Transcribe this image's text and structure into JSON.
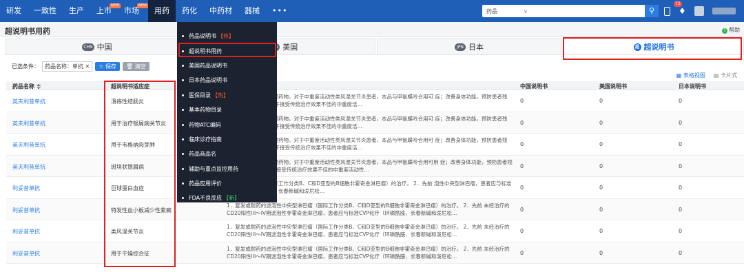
{
  "nav": {
    "items": [
      {
        "label": "研发",
        "tag": ""
      },
      {
        "label": "一致性",
        "tag": ""
      },
      {
        "label": "生产",
        "tag": ""
      },
      {
        "label": "上市",
        "tag": "NEW"
      },
      {
        "label": "市场",
        "tag": "NEW"
      },
      {
        "label": "用药",
        "tag": ""
      },
      {
        "label": "药化",
        "tag": ""
      },
      {
        "label": "中药材",
        "tag": ""
      },
      {
        "label": "器械",
        "tag": ""
      }
    ],
    "more": "•••",
    "search_category": "药品",
    "search_caret": "∨",
    "search_icon": "⚲",
    "notification_count": "72"
  },
  "header": {
    "title": "超说明书用药",
    "help": "帮助",
    "help_icon": "!"
  },
  "tabs": [
    {
      "flag": "CHN",
      "label": "中国"
    },
    {
      "flag": "USA",
      "label": "美国"
    },
    {
      "flag": "JPN",
      "label": "日本"
    },
    {
      "flag": "超",
      "label": "超说明书"
    }
  ],
  "filters": {
    "label": "已选条件：",
    "chip": "药品名称：单抗 ✕",
    "save": "☆ 保存",
    "clear": "🗑 清空"
  },
  "views": {
    "table": "▦ 表格视图",
    "card": "▤ 卡片式"
  },
  "table": {
    "headers": [
      "药品名称 ≑",
      "超说明书适应症",
      "中国说明书",
      "美国说明书",
      "日本说明书"
    ],
    "rows": [
      {
        "name": "英夫利昔单抗",
        "indication": "溃疡性结肠炎",
        "desc": "品是疾病控制性抗风湿药物。对于中重度活动性类风湿关节炎患者，本品与甲氨蝶呤合用可 症；改善身体功能，预防患者残疾。 2．克罗恩病 对于接受传统治疗效果不佳的中重度活…",
        "cn": "0",
        "us": "0",
        "jp": "0"
      },
      {
        "name": "英夫利昔单抗",
        "indication": "用于治疗银屑病关节炎",
        "desc": "品是疾病控制性抗风湿药物。对于中重度活动性类风湿关节炎患者，本品与甲氨蝶呤合用可 症；改善身体功能，预防患者残疾。 2．克罗恩病 对于接受传统治疗效果不佳的中重度活…",
        "cn": "0",
        "us": "0",
        "jp": "0"
      },
      {
        "name": "英夫利昔单抗",
        "indication": "用于韦格纳肉芽肿",
        "desc": "品是疾病控制性抗风湿药物。对于中重度活动性类风湿关节炎患者，本品与甲氨蝶呤合用可 症；改善身体功能，预防患者残疾。 2．克罗恩病 对于接受传统治疗效果不佳的中重度活…",
        "cn": "0",
        "us": "0",
        "jp": "0"
      },
      {
        "name": "英夫利昔单抗",
        "indication": "斑块状银屑病",
        "desc": "品是疾病控制性抗风湿药物。对于中重度活动性类风湿关节炎患者，本品与甲氨蝶呤合用可用 症；改善身体功能，预防患者残疾。 2.克罗恩病 对于接受传统治疗效果不佳的中重度活动性…",
        "cn": "0",
        "us": "0",
        "jp": "0"
      },
      {
        "name": "利妥昔单抗",
        "indication": "巨球蛋白血症",
        "desc": "性中央型淋巴瘤（国际工作分类B、C和D亚型的B细胞非霍奇金淋巴瘤）的治疗。 2．先前 泡性中央型淋巴瘤，患者应与标准CVP化疗（环磷酰胺、长春新碱和泼尼松…",
        "cn": "0",
        "us": "0",
        "jp": "0"
      },
      {
        "name": "利妥昔单抗",
        "indication": "特发性血小板减少性紫癜",
        "desc": "1．复发或耐药的滤泡性中央型淋巴瘤（国际工作分类B、C和D亚型的B细胞非霍奇金淋巴瘤）的治疗。 2．先前 未经治疗的CD20阳性III～IV期滤泡性非霍奇金淋巴瘤，患者应与标准CVP化疗（环磷酰胺、长春新碱和泼尼松…",
        "cn": "0",
        "us": "0",
        "jp": "0"
      },
      {
        "name": "利妥昔单抗",
        "indication": "类风湿关节炎",
        "desc": "1．复发或耐药的滤泡性中央型淋巴瘤（国际工作分类B、C和D亚型的B细胞非霍奇金淋巴瘤）的治疗。 2．先前 未经治疗的CD20阳性III～IV期滤泡性非霍奇金淋巴瘤，患者应与标准CVP化疗（环磷酰胺、长春新碱和泼尼松…",
        "cn": "0",
        "us": "0",
        "jp": "0"
      },
      {
        "name": "利妥昔单抗",
        "indication": "用于干燥综合征",
        "desc": "1．复发或耐药的滤泡性中央型淋巴瘤（国际工作分类B、C和D亚型的B细胞非霍奇金淋巴瘤）的治疗。 2．先前 未经治疗的CD20阳性III～IV期滤泡性非霍奇金淋巴瘤，患者应与标准CVP化疗（环磷酰胺、长春新碱和泼尼松…",
        "cn": "0",
        "us": "0",
        "jp": "0"
      }
    ]
  },
  "dropdown": {
    "items": [
      {
        "label": "药品说明书",
        "tag": "【热】",
        "tag_type": "hot"
      },
      {
        "label": "超说明书用药",
        "tag": "",
        "tag_type": ""
      },
      {
        "label": "美国药品说明书",
        "tag": "",
        "tag_type": ""
      },
      {
        "label": "日本药品说明书",
        "tag": "",
        "tag_type": ""
      },
      {
        "label": "医保目录",
        "tag": "【热】",
        "tag_type": "hot"
      },
      {
        "label": "基本药物目录",
        "tag": "",
        "tag_type": ""
      },
      {
        "label": "药物ATC编码",
        "tag": "",
        "tag_type": ""
      },
      {
        "label": "临床诊疗指南",
        "tag": "",
        "tag_type": ""
      },
      {
        "label": "药品商品名",
        "tag": "",
        "tag_type": ""
      },
      {
        "label": "辅助与重点监控用药",
        "tag": "",
        "tag_type": ""
      },
      {
        "label": "药品应用评价",
        "tag": "",
        "tag_type": ""
      },
      {
        "label": "FDA不良反应",
        "tag": "【新】",
        "tag_type": "new"
      }
    ]
  },
  "colors": {
    "nav_bg": "#1f5fb8",
    "accent": "#2a7de1",
    "highlight_box": "#e02020",
    "dropdown_bg": "#1b2230"
  }
}
